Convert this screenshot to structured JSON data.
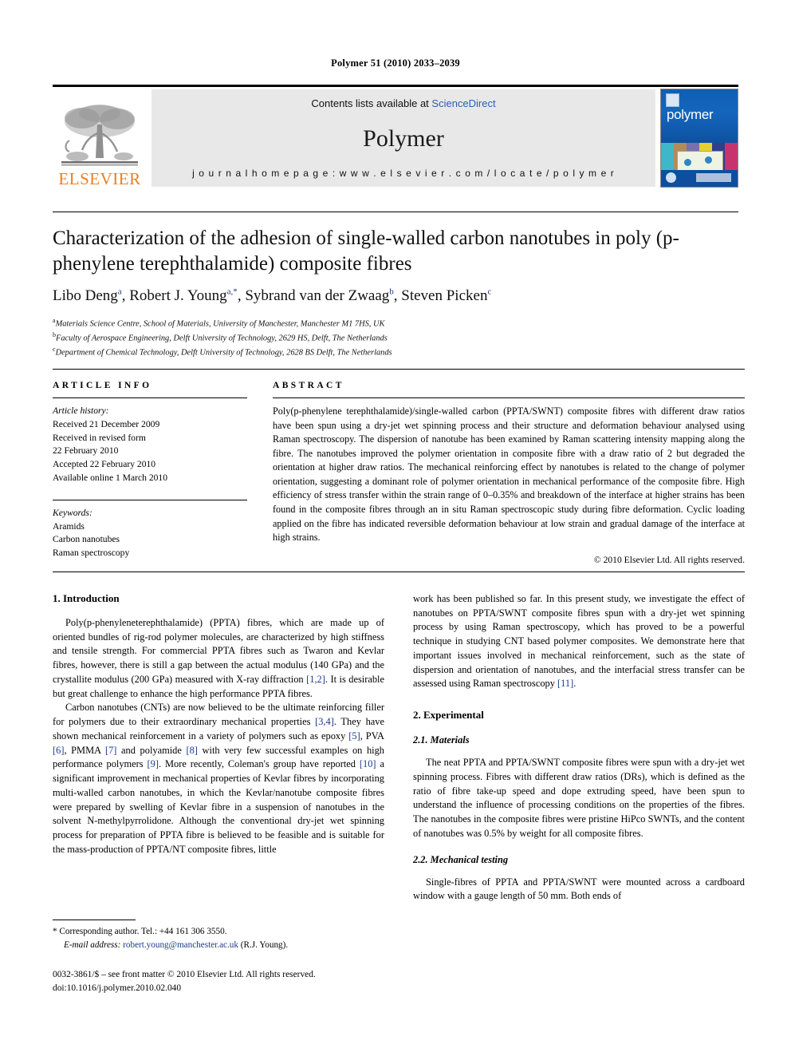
{
  "running_head": "Polymer 51 (2010) 2033–2039",
  "masthead": {
    "publisher_name": "ELSEVIER",
    "contents_prefix": "Contents lists available at ",
    "contents_link": "ScienceDirect",
    "journal_name": "Polymer",
    "homepage": "j o u r n a l   h o m e p a g e :   w w w . e l s e v i e r . c o m / l o c a t e / p o l y m e r",
    "cover_title": "polymer",
    "link_color": "#2b61ad",
    "elsevier_orange": "#f07d1a"
  },
  "article": {
    "title": "Characterization of the adhesion of single-walled carbon nanotubes in poly (p-phenylene terephthalamide) composite fibres",
    "authors_html": "Libo Deng<sup>a</sup>, Robert J. Young<sup>a,*</sup>, Sybrand van der Zwaag<sup>b</sup>, Steven Picken<sup>c</sup>",
    "affiliations": [
      "Materials Science Centre, School of Materials, University of Manchester, Manchester M1 7HS, UK",
      "Faculty of Aerospace Engineering, Delft University of Technology, 2629 HS, Delft, The Netherlands",
      "Department of Chemical Technology, Delft University of Technology, 2628 BS Delft, The Netherlands"
    ],
    "affiliation_marks": [
      "a",
      "b",
      "c"
    ]
  },
  "article_info": {
    "heading": "ARTICLE INFO",
    "history_label": "Article history:",
    "history": [
      "Received 21 December 2009",
      "Received in revised form",
      "22 February 2010",
      "Accepted 22 February 2010",
      "Available online 1 March 2010"
    ],
    "keywords_label": "Keywords:",
    "keywords": [
      "Aramids",
      "Carbon nanotubes",
      "Raman spectroscopy"
    ]
  },
  "abstract": {
    "heading": "ABSTRACT",
    "text": "Poly(p-phenylene terephthalamide)/single-walled carbon (PPTA/SWNT) composite fibres with different draw ratios have been spun using a dry-jet wet spinning process and their structure and deformation behaviour analysed using Raman spectroscopy. The dispersion of nanotube has been examined by Raman scattering intensity mapping along the fibre. The nanotubes improved the polymer orientation in composite fibre with a draw ratio of 2 but degraded the orientation at higher draw ratios. The mechanical reinforcing effect by nanotubes is related to the change of polymer orientation, suggesting a dominant role of polymer orientation in mechanical performance of the composite fibre. High efficiency of stress transfer within the strain range of 0–0.35% and breakdown of the interface at higher strains has been found in the composite fibres through an in situ Raman spectroscopic study during fibre deformation. Cyclic loading applied on the fibre has indicated reversible deformation behaviour at low strain and gradual damage of the interface at high strains.",
    "copyright": "© 2010 Elsevier Ltd. All rights reserved."
  },
  "body": {
    "left": {
      "section_heading": "1. Introduction",
      "paragraph_1_a": "Poly(p-phenyleneterephthalamide) (PPTA) fibres, which are made up of oriented bundles of rig-rod polymer molecules, are characterized by high stiffness and tensile strength. For commercial PPTA fibres such as Twaron and Kevlar fibres, however, there is still a gap between the actual modulus (140 GPa) and the crystallite modulus (200 GPa) measured with X-ray diffraction ",
      "paragraph_1_ref": "[1,2]",
      "paragraph_1_b": ". It is desirable but great challenge to enhance the high performance PPTA fibres.",
      "paragraph_2_a": "Carbon nanotubes (CNTs) are now believed to be the ultimate reinforcing filler for polymers due to their extraordinary mechanical properties ",
      "paragraph_2_r1": "[3,4]",
      "paragraph_2_b": ". They have shown mechanical reinforcement in a variety of polymers such as epoxy ",
      "paragraph_2_r2": "[5]",
      "paragraph_2_c": ", PVA ",
      "paragraph_2_r3": "[6]",
      "paragraph_2_d": ", PMMA ",
      "paragraph_2_r4": "[7]",
      "paragraph_2_e": " and polyamide ",
      "paragraph_2_r5": "[8]",
      "paragraph_2_f": " with very few successful examples on high performance polymers ",
      "paragraph_2_r6": "[9]",
      "paragraph_2_g": ". More recently, Coleman's group have reported ",
      "paragraph_2_r7": "[10]",
      "paragraph_2_h": " a significant improvement in mechanical properties of Kevlar fibres by incorporating multi-walled carbon nanotubes, in which the Kevlar/nanotube composite fibres were prepared by swelling of Kevlar fibre in a suspension of nanotubes in the solvent N-methylpyrrolidone. Although the conventional dry-jet wet spinning process for preparation of PPTA fibre is believed to be feasible and is suitable for the mass-production of PPTA/NT composite fibres, little"
    },
    "right": {
      "continuation_a": "work has been published so far. In this present study, we investigate the effect of nanotubes on PPTA/SWNT composite fibres spun with a dry-jet wet spinning process by using Raman spectroscopy, which has proved to be a powerful technique in studying CNT based polymer composites. We demonstrate here that important issues involved in mechanical reinforcement, such as the state of dispersion and orientation of nanotubes, and the interfacial stress transfer can be assessed using Raman spectroscopy ",
      "continuation_ref": "[11]",
      "continuation_b": ".",
      "section_heading": "2. Experimental",
      "subsection_1": "2.1. Materials",
      "paragraph_materials": "The neat PPTA and PPTA/SWNT composite fibres were spun with a dry-jet wet spinning process. Fibres with different draw ratios (DRs), which is defined as the ratio of fibre take-up speed and dope extruding speed, have been spun to understand the influence of processing conditions on the properties of the fibres. The nanotubes in the composite fibres were pristine HiPco SWNTs, and the content of nanotubes was 0.5% by weight for all composite fibres.",
      "subsection_2": "2.2. Mechanical testing",
      "paragraph_mechanical": "Single-fibres of PPTA and PPTA/SWNT were mounted across a cardboard window with a gauge length of 50 mm. Both ends of"
    }
  },
  "footer": {
    "corresponding": "* Corresponding author. Tel.: +44 161 306 3550.",
    "email_label": "E-mail address:",
    "email": "robert.young@manchester.ac.uk",
    "email_suffix": "(R.J. Young).",
    "issn_line": "0032-3861/$ – see front matter © 2010 Elsevier Ltd. All rights reserved.",
    "doi_line": "doi:10.1016/j.polymer.2010.02.040"
  }
}
